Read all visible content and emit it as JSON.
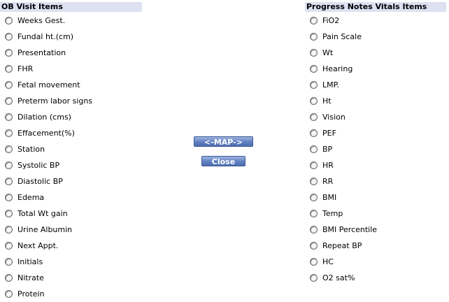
{
  "left_panel": {
    "title": "OB Visit Items",
    "items": [
      "Weeks Gest.",
      "Fundal ht.(cm)",
      "Presentation",
      "FHR",
      "Fetal movement",
      "Preterm labor signs",
      "Dilation (cms)",
      "Effacement(%)",
      "Station",
      "Systolic BP",
      "Diastolic BP",
      "Edema",
      "Total Wt gain",
      "Urine Albumin",
      "Next Appt.",
      "Initials",
      "Nitrate",
      "Protein"
    ]
  },
  "right_panel": {
    "title": "Progress Notes Vitals Items",
    "items": [
      "FiO2",
      "Pain Scale",
      "Wt",
      "Hearing",
      "LMP.",
      "Ht",
      "Vision",
      "PEF",
      "BP",
      "HR",
      "RR",
      "BMI",
      "Temp",
      "BMI Percentile",
      "Repeat BP",
      "HC",
      "O2 sat%"
    ]
  },
  "buttons": {
    "map_label": "<-MAP->",
    "close_label": "Close"
  },
  "colors": {
    "header_bg": "#dde1f2",
    "button_bg": "#5f7fc0",
    "button_text": "#ffffff"
  }
}
